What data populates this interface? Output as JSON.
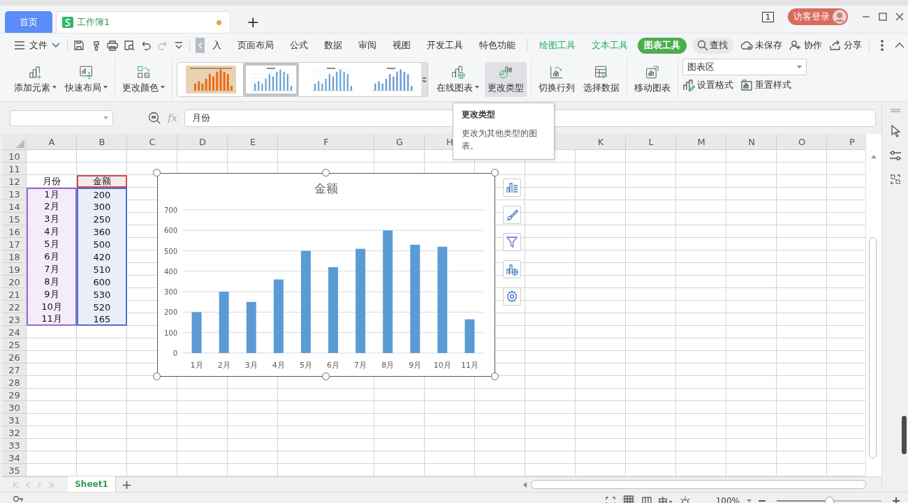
{
  "window": {
    "tabs": [
      {
        "label": "首页",
        "kind": "home",
        "selected": false
      },
      {
        "label": "工作簿1",
        "kind": "sheet",
        "selected": true,
        "unsaved": true
      }
    ],
    "new_tab": "+",
    "page_count": "1",
    "login": "访客登录"
  },
  "menu": {
    "file": "文件",
    "tabs": [
      {
        "label": "入",
        "kind": "normal",
        "selected": false
      },
      {
        "label": "页面布局",
        "kind": "normal",
        "selected": false
      },
      {
        "label": "公式",
        "kind": "normal",
        "selected": false
      },
      {
        "label": "数据",
        "kind": "normal",
        "selected": false
      },
      {
        "label": "审阅",
        "kind": "normal",
        "selected": false
      },
      {
        "label": "视图",
        "kind": "normal",
        "selected": false
      },
      {
        "label": "开发工具",
        "kind": "normal",
        "selected": false
      },
      {
        "label": "特色功能",
        "kind": "normal",
        "selected": false
      },
      {
        "label": "绘图工具",
        "kind": "context",
        "selected": false
      },
      {
        "label": "文本工具",
        "kind": "context",
        "selected": false
      },
      {
        "label": "图表工具",
        "kind": "context",
        "selected": true
      }
    ],
    "search": "查找",
    "actions": [
      {
        "label": "未保存",
        "kind": "cloud"
      },
      {
        "label": "协作",
        "kind": "collab"
      },
      {
        "label": "分享",
        "kind": "share"
      }
    ]
  },
  "ribbon": {
    "groups": [
      [
        {
          "kind": "add-element",
          "label": "添加元素",
          "dropdown": true,
          "hovered": false
        },
        {
          "kind": "quick-layout",
          "label": "快速布局",
          "dropdown": true,
          "hovered": false
        }
      ],
      [
        {
          "kind": "change-color",
          "label": "更改颜色",
          "dropdown": true,
          "hovered": false
        }
      ],
      [
        {
          "kind": "gallery",
          "styles": [
            {
              "kind": "orange",
              "selected": false
            },
            {
              "kind": "blue",
              "selected": true
            },
            {
              "kind": "lines",
              "selected": false
            },
            {
              "kind": "dotted",
              "selected": false
            }
          ]
        },
        {
          "kind": "online-chart",
          "label": "在线图表",
          "dropdown": true,
          "hovered": false
        },
        {
          "kind": "change-type",
          "label": "更改类型",
          "dropdown": false,
          "hovered": true
        }
      ],
      [
        {
          "kind": "switch",
          "label": "切换行列",
          "dropdown": false,
          "hovered": false
        },
        {
          "kind": "select-data",
          "label": "选择数据",
          "dropdown": false,
          "hovered": false
        }
      ],
      [
        {
          "kind": "move-chart",
          "label": "移动图表",
          "dropdown": false,
          "hovered": false
        }
      ]
    ],
    "element_select": "图表区",
    "small_buttons": [
      {
        "kind": "format",
        "label": "设置格式"
      },
      {
        "kind": "reset",
        "label": "重置样式"
      }
    ]
  },
  "formula_bar": {
    "fx": "fx",
    "value": "月份"
  },
  "tooltip": {
    "title": "更改类型",
    "text": "更改为其他类型的图表。"
  },
  "sheet": {
    "columns": [
      "A",
      "B",
      "C",
      "D",
      "E",
      "F",
      "G",
      "H",
      null,
      null,
      "K",
      "L",
      "M",
      "N",
      "O",
      "P"
    ],
    "rows": [
      {
        "header": "10"
      },
      {
        "header": "11"
      },
      {
        "header": "12",
        "cells": [
          {
            "text": "月份"
          },
          {
            "text": "金额",
            "color": "#c9504f"
          }
        ]
      },
      {
        "header": "13",
        "cells": [
          {
            "text": "1月",
            "color": "#9a6cc9"
          },
          {
            "text": "200",
            "color": "#4a72d0"
          }
        ]
      },
      {
        "header": "14",
        "cells": [
          {
            "text": "2月",
            "color": "#9a6cc9"
          },
          {
            "text": "300",
            "color": "#4a72d0"
          }
        ]
      },
      {
        "header": "15",
        "cells": [
          {
            "text": "3月",
            "color": "#9a6cc9"
          },
          {
            "text": "250",
            "color": "#4a72d0"
          }
        ]
      },
      {
        "header": "16",
        "cells": [
          {
            "text": "4月",
            "color": "#9a6cc9"
          },
          {
            "text": "360",
            "color": "#4a72d0"
          }
        ]
      },
      {
        "header": "17",
        "cells": [
          {
            "text": "5月",
            "color": "#9a6cc9"
          },
          {
            "text": "500",
            "color": "#4a72d0"
          }
        ]
      },
      {
        "header": "18",
        "cells": [
          {
            "text": "6月",
            "color": "#9a6cc9"
          },
          {
            "text": "420",
            "color": "#4a72d0"
          }
        ]
      },
      {
        "header": "19",
        "cells": [
          {
            "text": "7月",
            "color": "#9a6cc9"
          },
          {
            "text": "510",
            "color": "#4a72d0"
          }
        ]
      },
      {
        "header": "20",
        "cells": [
          {
            "text": "8月",
            "color": "#9a6cc9"
          },
          {
            "text": "600",
            "color": "#4a72d0"
          }
        ]
      },
      {
        "header": "21",
        "cells": [
          {
            "text": "9月",
            "color": "#9a6cc9"
          },
          {
            "text": "530",
            "color": "#4a72d0"
          }
        ]
      },
      {
        "header": "22",
        "cells": [
          {
            "text": "10月",
            "color": "#9a6cc9"
          },
          {
            "text": "520",
            "color": "#4a72d0"
          }
        ]
      },
      {
        "header": "23",
        "cells": [
          {
            "text": "11月",
            "color": "#9a6cc9"
          },
          {
            "text": "165",
            "color": "#4a72d0"
          }
        ]
      },
      {
        "header": "24"
      },
      {
        "header": "25"
      },
      {
        "header": "26"
      },
      {
        "header": "27"
      },
      {
        "header": "28"
      },
      {
        "header": "29"
      },
      {
        "header": "30"
      },
      {
        "header": "31"
      },
      {
        "header": "32"
      },
      {
        "header": "33"
      },
      {
        "header": "34"
      },
      {
        "header": "35"
      }
    ]
  },
  "chart": {
    "chart_data": {
      "type": "bar",
      "title": "金额",
      "categories": [
        "1月",
        "2月",
        "3月",
        "4月",
        "5月",
        "6月",
        "7月",
        "8月",
        "9月",
        "10月",
        "11月"
      ],
      "values": [
        200,
        300,
        250,
        360,
        500,
        420,
        510,
        600,
        530,
        520,
        165
      ],
      "ylim": [
        0,
        700
      ],
      "yticks": [
        0,
        100,
        200,
        300,
        400,
        500,
        600,
        700
      ],
      "grid": true
    }
  },
  "sheet_tabs": [
    {
      "label": "Sheet1",
      "selected": true
    }
  ],
  "add_sheet": "+",
  "status_bar": {
    "zoom": "100%",
    "zoom_slider": {
      "level": 0.5
    }
  }
}
